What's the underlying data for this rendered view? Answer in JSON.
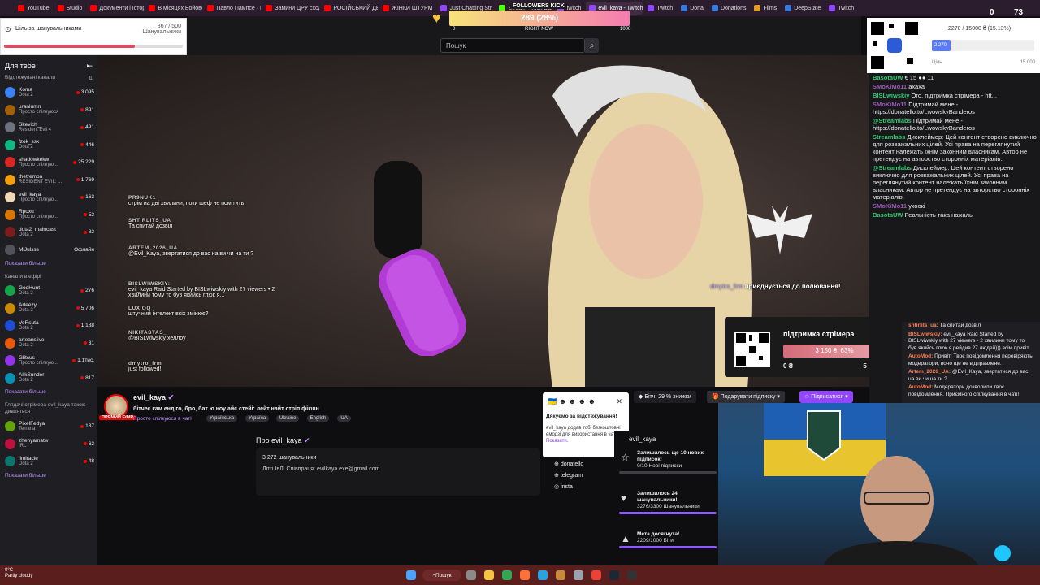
{
  "browser_tabs": [
    {
      "label": "YouTube",
      "color": "#ff0000"
    },
    {
      "label": "Studio",
      "color": "#ff0000"
    },
    {
      "label": "Документи і Історія",
      "color": "#ff0000"
    },
    {
      "label": "В місяцях Бойового",
      "color": "#ff0000"
    },
    {
      "label": "Павло Пампсе · КР",
      "color": "#ff0000"
    },
    {
      "label": "Замини ЦРУ сходу",
      "color": "#ff0000"
    },
    {
      "label": "РОСІЙСЬКИЙ ДЕ",
      "color": "#ff0000"
    },
    {
      "label": "ЖІНКИ ШТУРМ",
      "color": "#ff0000"
    },
    {
      "label": "Just Chatting Str",
      "color": "#9147ff"
    },
    {
      "label": "Stream · Kick Dash",
      "color": "#53fc18"
    },
    {
      "label": "twitch",
      "color": "#9147ff"
    },
    {
      "label": "evil_kaya - Twitch",
      "color": "#9147ff"
    },
    {
      "label": "Twitch",
      "color": "#9147ff"
    },
    {
      "label": "Dona",
      "color": "#3a7bd5"
    },
    {
      "label": "Donations",
      "color": "#3a7bd5"
    },
    {
      "label": "Films",
      "color": "#e09c2a"
    },
    {
      "label": "DeepState",
      "color": "#3a7bd5"
    },
    {
      "label": "Twitch",
      "color": "#9147ff"
    }
  ],
  "follower_goal": {
    "label": "Ціль за шанувальниками",
    "value": "367 / 500",
    "unit": "Шанувальники",
    "fraction": 0.734
  },
  "followers_bar": {
    "title": "FOLLOWERS KICK",
    "value": "289 (28%)",
    "min": "0",
    "now": "RIGHT NOW",
    "max": "1000"
  },
  "search": {
    "placeholder": "Пошук"
  },
  "top_right": {
    "count_a": "0",
    "count_b": "73"
  },
  "sidebar": {
    "for_you": "Для тебе",
    "followed_header": "Відстежувані канали",
    "followed": [
      {
        "name": "Koma",
        "sub": "Dota 2",
        "viewers": "3 095",
        "color": "#3b82f6"
      },
      {
        "name": "uranlumrr",
        "sub": "Просто спілкуюся",
        "viewers": "891",
        "color": "#a16207"
      },
      {
        "name": "Skevich_",
        "sub": "Resident Evil 4",
        "viewers": "491",
        "color": "#6b7280"
      },
      {
        "name": "fzok_ssk",
        "sub": "Dota 2",
        "viewers": "446",
        "color": "#10b981"
      },
      {
        "name": "shadowkekw",
        "sub": "Просто спілкую...",
        "viewers": "25 229",
        "color": "#dc2626"
      },
      {
        "name": "thetremba",
        "sub": "RESIDENT EVIL: ...",
        "viewers": "1 769",
        "color": "#f59e0b"
      },
      {
        "name": "evil_kaya",
        "sub": "Просто спілкую...",
        "viewers": "163",
        "color": "#f2d9b5"
      },
      {
        "name": "Rpoxu",
        "sub": "Просто спілкую...",
        "viewers": "52",
        "color": "#d97706"
      },
      {
        "name": "dota2_maincast",
        "sub": "Dota 2",
        "viewers": "82",
        "color": "#7f1d1d"
      },
      {
        "name": "MiJulsss",
        "sub": "",
        "viewers": "Офлайн",
        "color": "#52525b"
      }
    ],
    "show_more": "Показати більше",
    "live_header": "Канали в ефірі",
    "live": [
      {
        "name": "GodHunt",
        "sub": "Dota 2",
        "viewers": "276",
        "color": "#16a34a"
      },
      {
        "name": "Arteezy",
        "sub": "Dota 2",
        "viewers": "5 706",
        "color": "#ca8a04"
      },
      {
        "name": "VeRsuta",
        "sub": "Dota 2",
        "viewers": "1 188",
        "color": "#1d4ed8"
      },
      {
        "name": "arteanslive",
        "sub": "Dota 2",
        "viewers": "31",
        "color": "#ea580c"
      },
      {
        "name": "Glitcus",
        "sub": "Просто спілкую...",
        "viewers": "1,1тис.",
        "color": "#9333ea"
      },
      {
        "name": "AlikSunder",
        "sub": "Dota 2",
        "viewers": "817",
        "color": "#0891b2"
      }
    ],
    "show_more2": "Показати більше",
    "viewers_header": "Глядачі стрімера evil_kaya також дивляться",
    "also": [
      {
        "name": "PixelFedya",
        "sub": "Terraria",
        "viewers": "137",
        "color": "#65a30d"
      },
      {
        "name": "zhenyamatw",
        "sub": "IRL",
        "viewers": "62",
        "color": "#be123c"
      },
      {
        "name": "ilmiracle",
        "sub": "Dota 2",
        "viewers": "48",
        "color": "#0f766e"
      }
    ],
    "show_more3": "Показати більше"
  },
  "overlay_chat": [
    {
      "user": "PR9NUK1",
      "text": "стрім на дві хвилини, поки шеф не помітить"
    },
    {
      "user": "SHTIRLITS_UA",
      "text": "Та спитай дозвіл"
    },
    {
      "user": "ARTEM_2026_UA",
      "text": "@Evil_Kaya, звертатися до вас на ви чи на ти ?"
    },
    {
      "user": "BISLWIWSKIY:",
      "text": "evil_kaya Raid Started by BISLwiwskiy with 27 viewers • 2 хвилини тому то був якийсь глюк я..."
    },
    {
      "user": "LUXIQQ_",
      "text": "штучний інтелект всіх змінює?"
    },
    {
      "user": "NIKITASTAS_",
      "text": "@BISLwiwskiy хеллоу"
    },
    {
      "user": "dmytro_frm",
      "text": "just followed!"
    }
  ],
  "hunt_text": {
    "user": "dmytro_frm",
    "text": "приєднується до полювання!"
  },
  "support": {
    "title": "підтримка стрімера",
    "amount": "3 150 ₴, 63%",
    "min": "0 ₴",
    "max": "5 000 ₴"
  },
  "qr_goal": {
    "text": "2270 / 15000 ₴ (15.13%)",
    "fill_label": "2 270",
    "min": "Ціль",
    "max": "15 000",
    "fraction": 0.1513
  },
  "chat": [
    {
      "user": "BasotaUW",
      "color": "#2ecc71",
      "text": "€ 15 ●● 11"
    },
    {
      "user": "SMoKiMo11",
      "color": "#9b59b6",
      "text": "ахаха"
    },
    {
      "user": "BISLwiwskiy",
      "color": "#2ecc71",
      "text": "Ого, підтримка стрімера - htt..."
    },
    {
      "user": "SMoKiMo11",
      "color": "#9b59b6",
      "text": "Підтримай мене - https://donatello.to/LwowskyBanderos"
    },
    {
      "user": "@Streamlabs",
      "color": "#2ecc71",
      "text": "Підтримай мене - https://donatello.to/LwowskyBanderos"
    },
    {
      "user": "Streamlabs",
      "color": "#2ecc71",
      "text": "Дисклеймер: Цей контент створено виключно для розважальних цілей. Усі права на переглянутий контент належать їхнім законним власникам. Автор не претендує на авторство сторонніх матеріалів."
    },
    {
      "user": "@Streamlabs",
      "color": "#2ecc71",
      "text": "Дисклеймер: Цей контент створено виключно для розважальних цілей. Усі права на переглянутий контент належать їхнім законним власникам. Автор не претендує на авторство сторонніх матеріалів."
    },
    {
      "user": "SMoKiMo11",
      "color": "#9b59b6",
      "text": "укоокі"
    },
    {
      "user": "BasotaUW",
      "color": "#2ecc71",
      "text": "Реальність така нажаль"
    },
    {
      "user": "",
      "color": "#ffffff",
      "text": ""
    }
  ],
  "chat2": [
    {
      "user": "shtirlits_ua:",
      "text": "Та спитай дозвіл"
    },
    {
      "user": "BISLwiwskiy:",
      "text": "evil_kaya Raid Started by BISLwiwskiy with 27 viewers • 2 хвилини тому то був якийсь глюк я рейдив 27 людей))) всім привіт"
    },
    {
      "user": "AutoMod:",
      "text": "Привіт! Твоє повідомлення перевіряють модератори, воно ще не відправлене."
    },
    {
      "user": "Artem_2026_UA:",
      "text": "@Evil_Kaya, звертатися до вас на ви чи на ти ?"
    },
    {
      "user": "AutoMod:",
      "text": "Модератори дозволили твоє повідомлення. Приємного спілкування в чаті!"
    }
  ],
  "streamer": {
    "name": "evil_kaya",
    "live": "ПРЯМИЙ ЕФІР",
    "title": "бітчес кам енд го, бро, бат ю ноу айс стейі: лейт найт стріп фікшн",
    "category": "Просто спілкуюся в чаті",
    "tags": [
      "Українська",
      "Україна",
      "Ukraine",
      "English",
      "UA"
    ]
  },
  "about": {
    "heading": "Про evil_kaya",
    "followers": "3 272 шанувальники",
    "desc": "Літгі ІвЛ. Співпраця: evilkaya.exe@gmail.com"
  },
  "links": [
    "donatello",
    "telegram",
    "insta"
  ],
  "popup": {
    "title": "Дякуємо за відстежування!",
    "desc": "evil_kaya додав тобі безкоштовні емодзі для використання в чаті!",
    "link": "Показати."
  },
  "actions": {
    "bits": "Бітч: 29 % знижки",
    "gift": "Подарувати підписку",
    "subscribe": "Підписатися"
  },
  "goals": {
    "title": "evil_kaya",
    "items": [
      {
        "title": "Залишилось ще 10 нових підписок!",
        "progress": "0/10 Нові підписки",
        "fraction": 0.0
      },
      {
        "title": "Залишилось 24 шанувальники!",
        "progress": "3276/3300 Шанувальники",
        "fraction": 0.993
      },
      {
        "title": "Мета досягнута!",
        "progress": "2209/1000 Біти",
        "fraction": 1.0
      }
    ]
  },
  "taskbar": {
    "weather_temp": "0°C",
    "weather_desc": "Partly cloudy",
    "search": "Пошук"
  }
}
